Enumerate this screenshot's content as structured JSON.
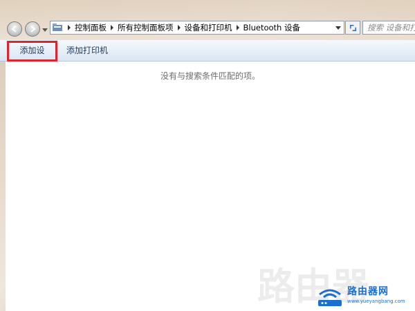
{
  "address_bar": {
    "breadcrumbs": [
      "控制面板",
      "所有控制面板项",
      "设备和打印机",
      "Bluetooth 设备"
    ]
  },
  "search": {
    "placeholder": "搜索 设备和打印机"
  },
  "command_bar": {
    "add_device": "添加设备",
    "add_printer": "添加打印机"
  },
  "content": {
    "empty_message": "没有与搜索条件匹配的项。"
  },
  "watermark": {
    "large_text": "路由器",
    "brand": "路由器网",
    "url": "www.yueyangbang.com"
  },
  "colors": {
    "highlight": "#d9252b",
    "brand": "#1a6fd0"
  },
  "icons": [
    "back-arrow-icon",
    "forward-arrow-icon",
    "history-dropdown-icon",
    "folder-icon",
    "breadcrumb-arrow-icon",
    "address-dropdown-icon",
    "refresh-icon"
  ]
}
